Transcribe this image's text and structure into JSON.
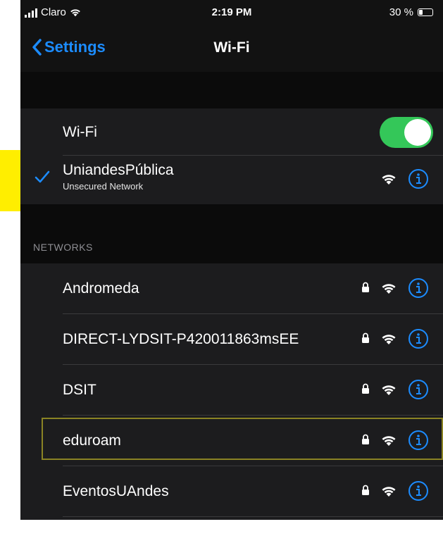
{
  "status_bar": {
    "carrier": "Claro",
    "time": "2:19 PM",
    "battery_text": "30 %",
    "battery_level": 0.3
  },
  "nav": {
    "back_label": "Settings",
    "title": "Wi-Fi"
  },
  "wifi_toggle": {
    "label": "Wi-Fi",
    "state": "on"
  },
  "connected_network": {
    "name": "UniandesPública",
    "subtitle": "Unsecured Network",
    "icons": [
      "checkmark-icon",
      "wifi-icon",
      "info-icon"
    ]
  },
  "networks_header": "NETWORKS",
  "networks": [
    {
      "name": "Andromeda",
      "secured": true,
      "selected": false
    },
    {
      "name": "DIRECT-LYDSIT-P420011863msEE",
      "secured": true,
      "selected": false
    },
    {
      "name": "DSIT",
      "secured": true,
      "selected": false
    },
    {
      "name": "eduroam",
      "secured": true,
      "selected": true
    },
    {
      "name": "EventosUAndes",
      "secured": true,
      "selected": false
    }
  ],
  "colors": {
    "accent_blue": "#1c8cff",
    "toggle_green": "#34c759",
    "highlight_yellow": "#ffee00",
    "selection_outline": "#8a8324"
  }
}
